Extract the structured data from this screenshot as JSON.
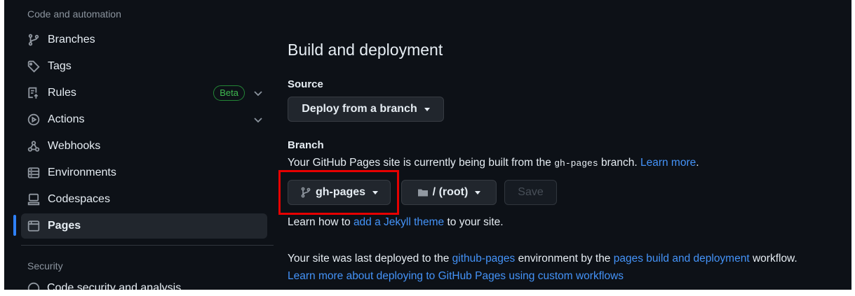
{
  "sidebar": {
    "section_code": "Code and automation",
    "items": [
      {
        "label": "Branches",
        "icon": "branch-icon"
      },
      {
        "label": "Tags",
        "icon": "tag-icon"
      },
      {
        "label": "Rules",
        "icon": "rules-icon",
        "badge": "Beta"
      },
      {
        "label": "Actions",
        "icon": "play-icon"
      },
      {
        "label": "Webhooks",
        "icon": "webhook-icon"
      },
      {
        "label": "Environments",
        "icon": "server-icon"
      },
      {
        "label": "Codespaces",
        "icon": "codespaces-icon"
      },
      {
        "label": "Pages",
        "icon": "browser-icon",
        "active": true
      }
    ],
    "section_security": "Security",
    "cut_item": "Code security and analysis"
  },
  "main": {
    "title": "Build and deployment",
    "source_label": "Source",
    "source_button": "Deploy from a branch",
    "branch_label": "Branch",
    "branch_text_before": "Your GitHub Pages site is currently being built from the ",
    "branch_code": "gh-pages",
    "branch_text_after": " branch. ",
    "learn_more": "Learn more",
    "branch_button": "gh-pages",
    "folder_button": "/ (root)",
    "save_button": "Save",
    "jekyll_before": "Learn how to ",
    "jekyll_link": "add a Jekyll theme",
    "jekyll_after": " to your site.",
    "deployed_before": "Your site was last deployed to the ",
    "deployed_env": "github-pages",
    "deployed_mid": " environment by the ",
    "deployed_workflow": "pages build and deployment",
    "deployed_after": " workflow.",
    "custom_workflows_link": "Learn more about deploying to GitHub Pages using custom workflows"
  },
  "colors": {
    "background": "#0d1117",
    "accent": "#2f81f7",
    "link": "#4493f8",
    "highlight": "#e60000",
    "badge": "#3fb950"
  }
}
